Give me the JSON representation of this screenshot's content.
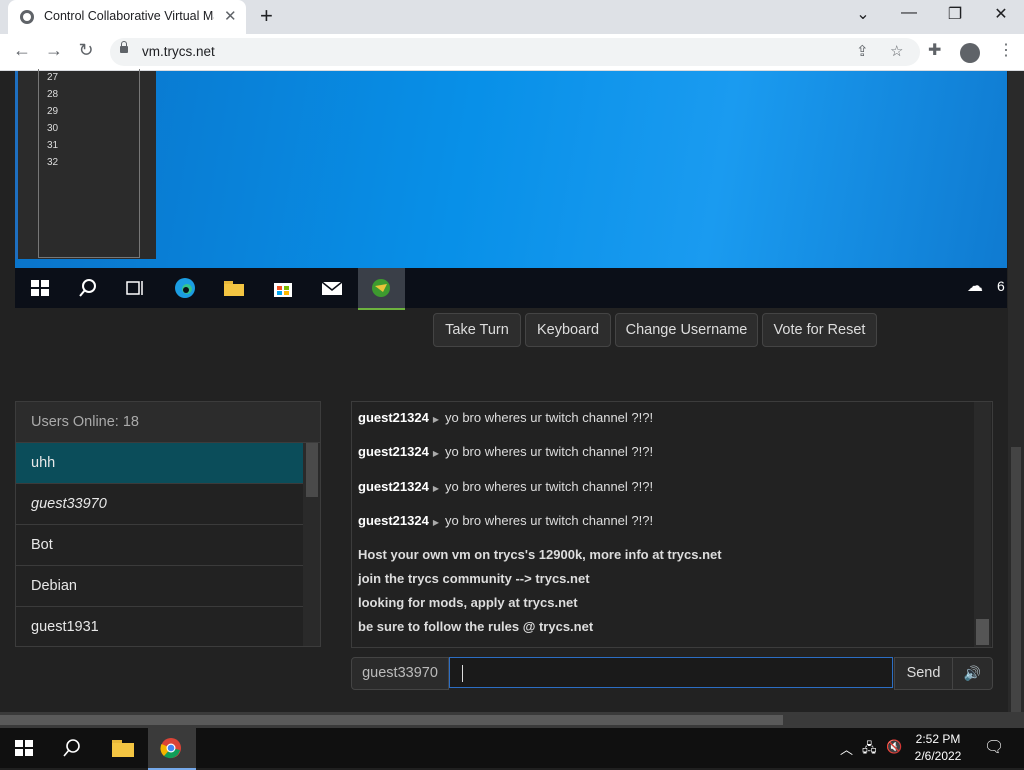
{
  "browser": {
    "tab_title": "Control Collaborative Virtual Mac",
    "url": "vm.trycs.net"
  },
  "vm": {
    "line_numbers": [
      "27",
      "28",
      "29",
      "30",
      "31",
      "32"
    ],
    "temp_partial": "6"
  },
  "controls": {
    "take_turn": "Take Turn",
    "keyboard": "Keyboard",
    "change_username": "Change Username",
    "vote_reset": "Vote for Reset"
  },
  "users": {
    "header": "Users Online: 18",
    "list": [
      "uhh",
      "guest33970",
      "Bot",
      "Debian",
      "guest1931"
    ]
  },
  "chat": {
    "messages": [
      {
        "user": "guest21324",
        "text": "yo bro wheres ur twitch channel ?!?!"
      },
      {
        "user": "guest21324",
        "text": "yo bro wheres ur twitch channel ?!?!"
      },
      {
        "user": "guest21324",
        "text": "yo bro wheres ur twitch channel ?!?!"
      },
      {
        "user": "guest21324",
        "text": "yo bro wheres ur twitch channel ?!?!"
      }
    ],
    "system": [
      "Host your own vm on trycs's 12900k, more info at trycs.net",
      "join the trycs community --> trycs.net",
      "looking for mods, apply at trycs.net",
      "be sure to follow the rules @ trycs.net"
    ],
    "username": "guest33970",
    "send_label": "Send"
  },
  "os": {
    "time": "2:52 PM",
    "date": "2/6/2022"
  },
  "colors": {
    "accent": "#0b4d5a",
    "input_border": "#2c6ec4"
  }
}
